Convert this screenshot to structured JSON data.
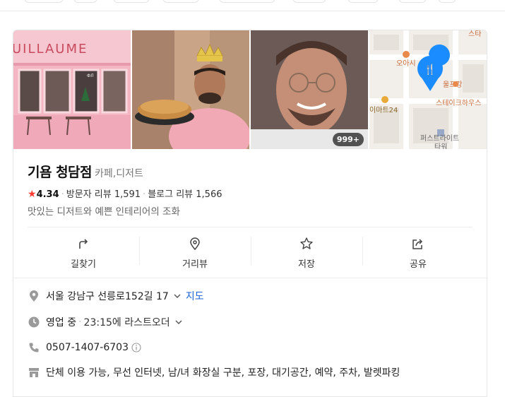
{
  "photos": {
    "storefront_sign": "UILLAUME",
    "window_text": "ФЛ",
    "more_count": "999+"
  },
  "map": {
    "labels": [
      "오아시",
      "울프강",
      "스테이크하우스",
      "이마트24",
      "퍼스트라이트",
      "타워",
      "스타"
    ],
    "pin_color": "#1a8cff"
  },
  "place": {
    "name": "기욤 청담점",
    "category": "카페,디저트",
    "rating": "4.34",
    "visitor_reviews": "방문자 리뷰 1,591",
    "blog_reviews": "블로그 리뷰 1,566",
    "tagline": "맛있는 디저트와 예쁜 인테리어의 조화"
  },
  "actions": [
    {
      "label": "길찾기",
      "icon": "directions-icon"
    },
    {
      "label": "거리뷰",
      "icon": "street-view-pin-icon"
    },
    {
      "label": "저장",
      "icon": "star-outline-icon"
    },
    {
      "label": "공유",
      "icon": "share-icon"
    }
  ],
  "info": {
    "address": "서울 강남구 선릉로152길 17",
    "map_link": "지도",
    "status": "영업 중",
    "last_order": "23:15에 라스트오더",
    "phone": "0507-1407-6703",
    "amenities": "단체 이용 가능, 무선 인터넷, 남/녀 화장실 구분, 포장, 대기공간, 예약, 주차, 발렛파킹"
  },
  "colors": {
    "rating_star": "#ff3b30",
    "link": "#1a62d8",
    "storefront": "#f3b6c2"
  }
}
